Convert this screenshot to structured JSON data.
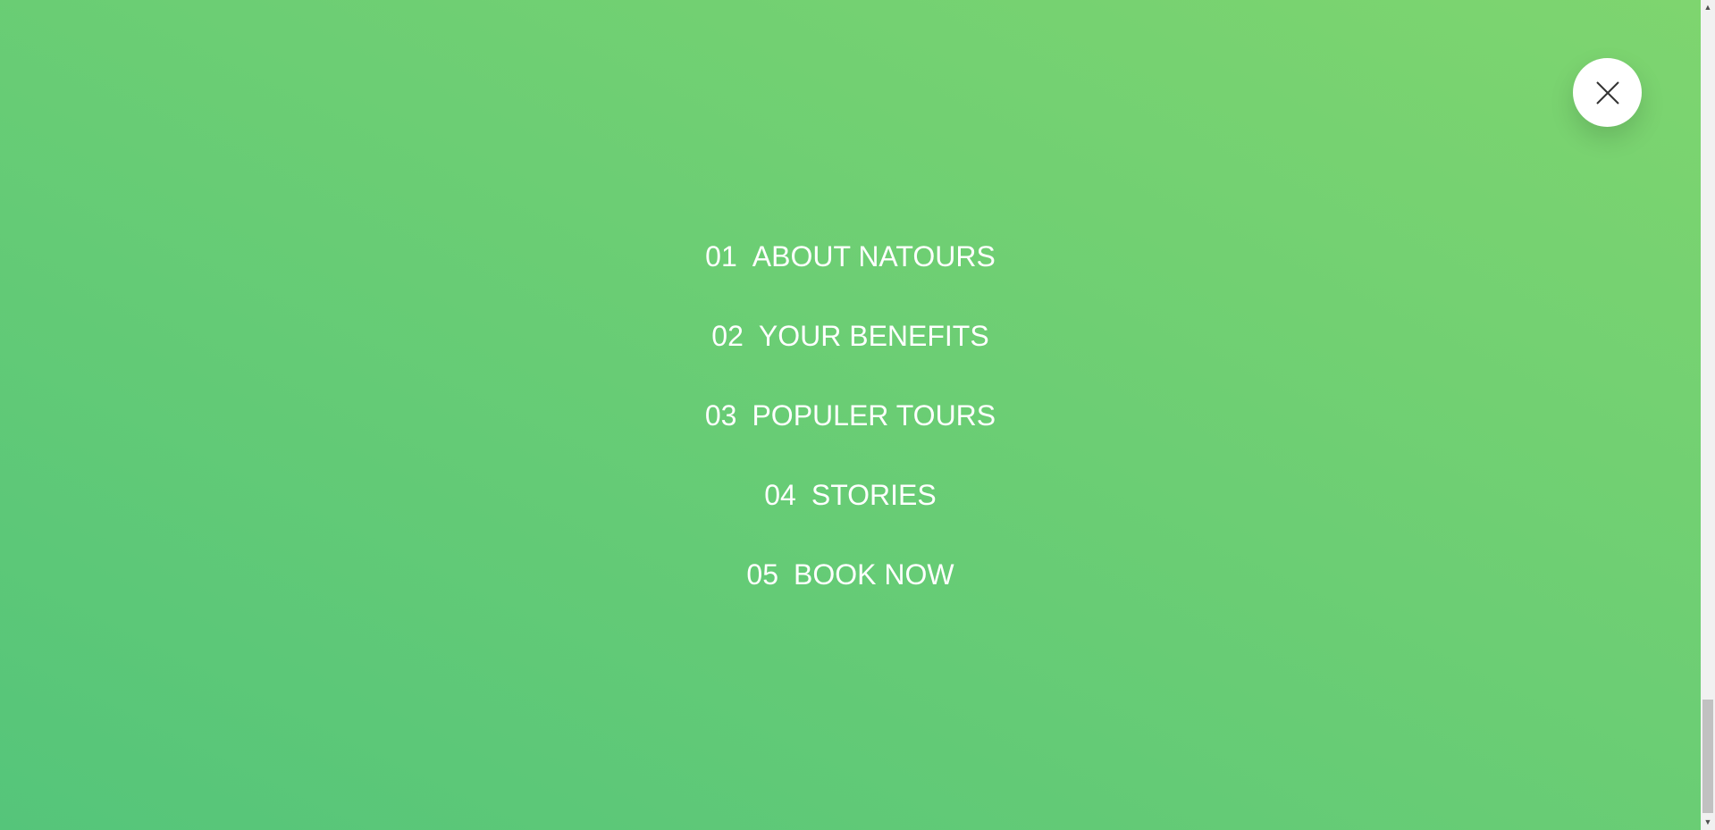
{
  "navigation": {
    "items": [
      {
        "number": "01",
        "label": "ABOUT NATOURS"
      },
      {
        "number": "02",
        "label": "YOUR BENEFITS"
      },
      {
        "number": "03",
        "label": "POPULER TOURS"
      },
      {
        "number": "04",
        "label": "STORIES"
      },
      {
        "number": "05",
        "label": "BOOK NOW"
      }
    ]
  },
  "close_button": {
    "icon": "close-icon"
  },
  "scrollbar": {
    "up_arrow": "▲",
    "down_arrow": "▼",
    "scroll_position": 1.0
  },
  "colors": {
    "gradient_start": "#55c57a",
    "gradient_end": "#7ed56f",
    "text": "#ffffff",
    "close_background": "#ffffff",
    "close_icon": "#333333"
  }
}
